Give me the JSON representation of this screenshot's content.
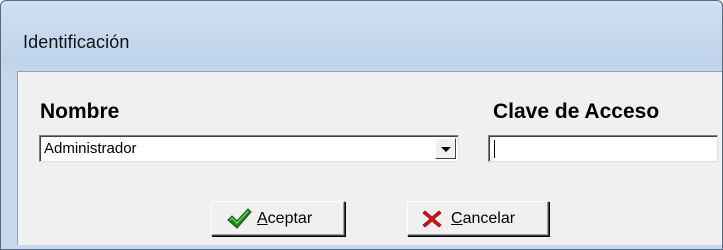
{
  "window": {
    "title": "Identificación"
  },
  "form": {
    "nombre_label": "Nombre",
    "clave_label": "Clave de Acceso",
    "nombre_value": "Administrador",
    "clave_value": ""
  },
  "buttons": {
    "accept_label": "Aceptar",
    "cancel_label": "Cancelar"
  },
  "icons": {
    "accept": "checkmark-icon",
    "cancel": "cross-icon",
    "dropdown": "chevron-down-icon"
  },
  "colors": {
    "titlebar": "#c5d8ee",
    "client": "#f0f0f0",
    "accept_icon": "#1f8a1f",
    "cancel_icon": "#e01010"
  }
}
